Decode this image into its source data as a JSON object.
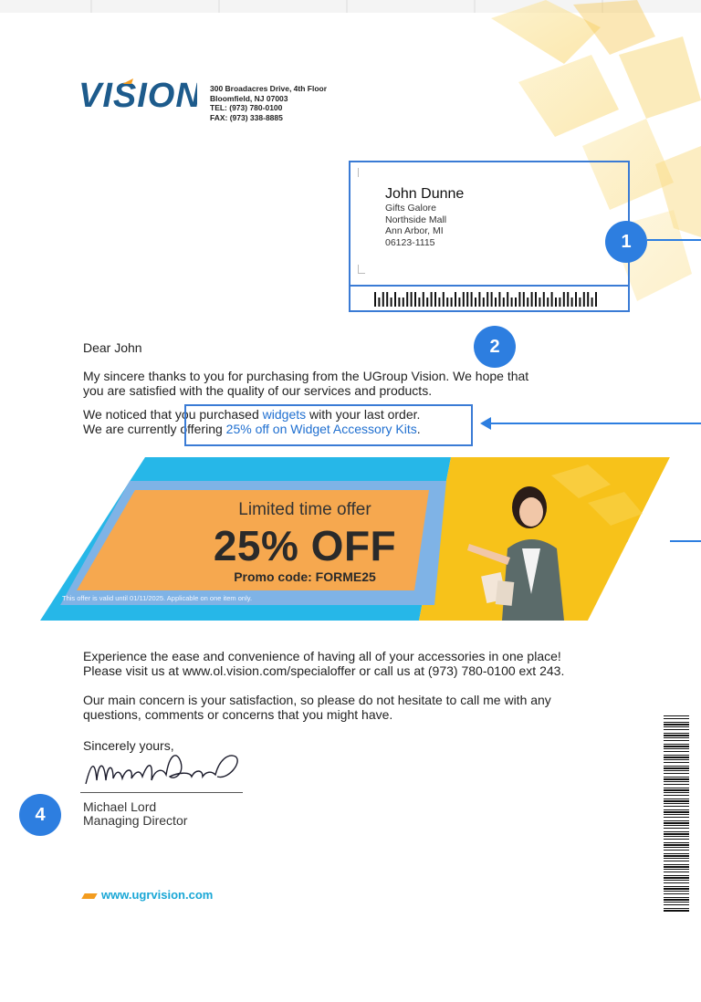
{
  "company": {
    "logo_text": "VISION",
    "address_lines": [
      "300 Broadacres Drive, 4th Floor",
      "Bloomfield, NJ 07003",
      "TEL: (973) 780-0100",
      "FAX: (973) 338-8885"
    ]
  },
  "recipient": {
    "name": "John Dunne",
    "lines": [
      "Gifts Galore",
      "Northside Mall",
      "Ann Arbor, MI",
      "06123-1115"
    ]
  },
  "badges": {
    "b1": "1",
    "b2": "2",
    "b4": "4"
  },
  "letter": {
    "salutation": "Dear John",
    "p1_line1": "My sincere thanks to you for purchasing from the UGroup Vision. We hope that",
    "p1_line2": "you are satisfied with the quality of our services and products.",
    "p2_line1_prefix": "We noticed that you purchased ",
    "p2_line1_link": "widgets",
    "p2_line1_suffix": " with your last order.",
    "p2_line2_prefix": "We are currently offering ",
    "p2_line2_link": "25% off on Widget Accessory Kits",
    "p2_line2_suffix": ".",
    "p3_line1": "Experience the ease and convenience of having all of your accessories in one place!",
    "p3_line2": "Please visit us at www.ol.vision.com/specialoffer or call us at (973) 780-0100 ext 243.",
    "p4_line1": "Our main concern is your satisfaction, so please do not hesitate to call me with any",
    "p4_line2": "questions, comments or concerns that you might have.",
    "closing": "Sincerely yours,",
    "signer_name": "Michael Lord",
    "signer_title": "Managing Director"
  },
  "banner": {
    "headline": "Limited time offer",
    "discount": "25% OFF",
    "promo": "Promo code: FORME25",
    "validity": "This offer is valid until 01/11/2025. Applicable on one item only."
  },
  "footer": {
    "website": "www.ugrvision.com"
  },
  "colors": {
    "accent_blue": "#2d7ee0",
    "link_blue": "#1f6fd0",
    "banner_orange": "#f6a84f",
    "banner_cyan": "#26b7e8",
    "banner_yellow": "#f7c21a",
    "footer_cyan": "#1aa7d6"
  }
}
